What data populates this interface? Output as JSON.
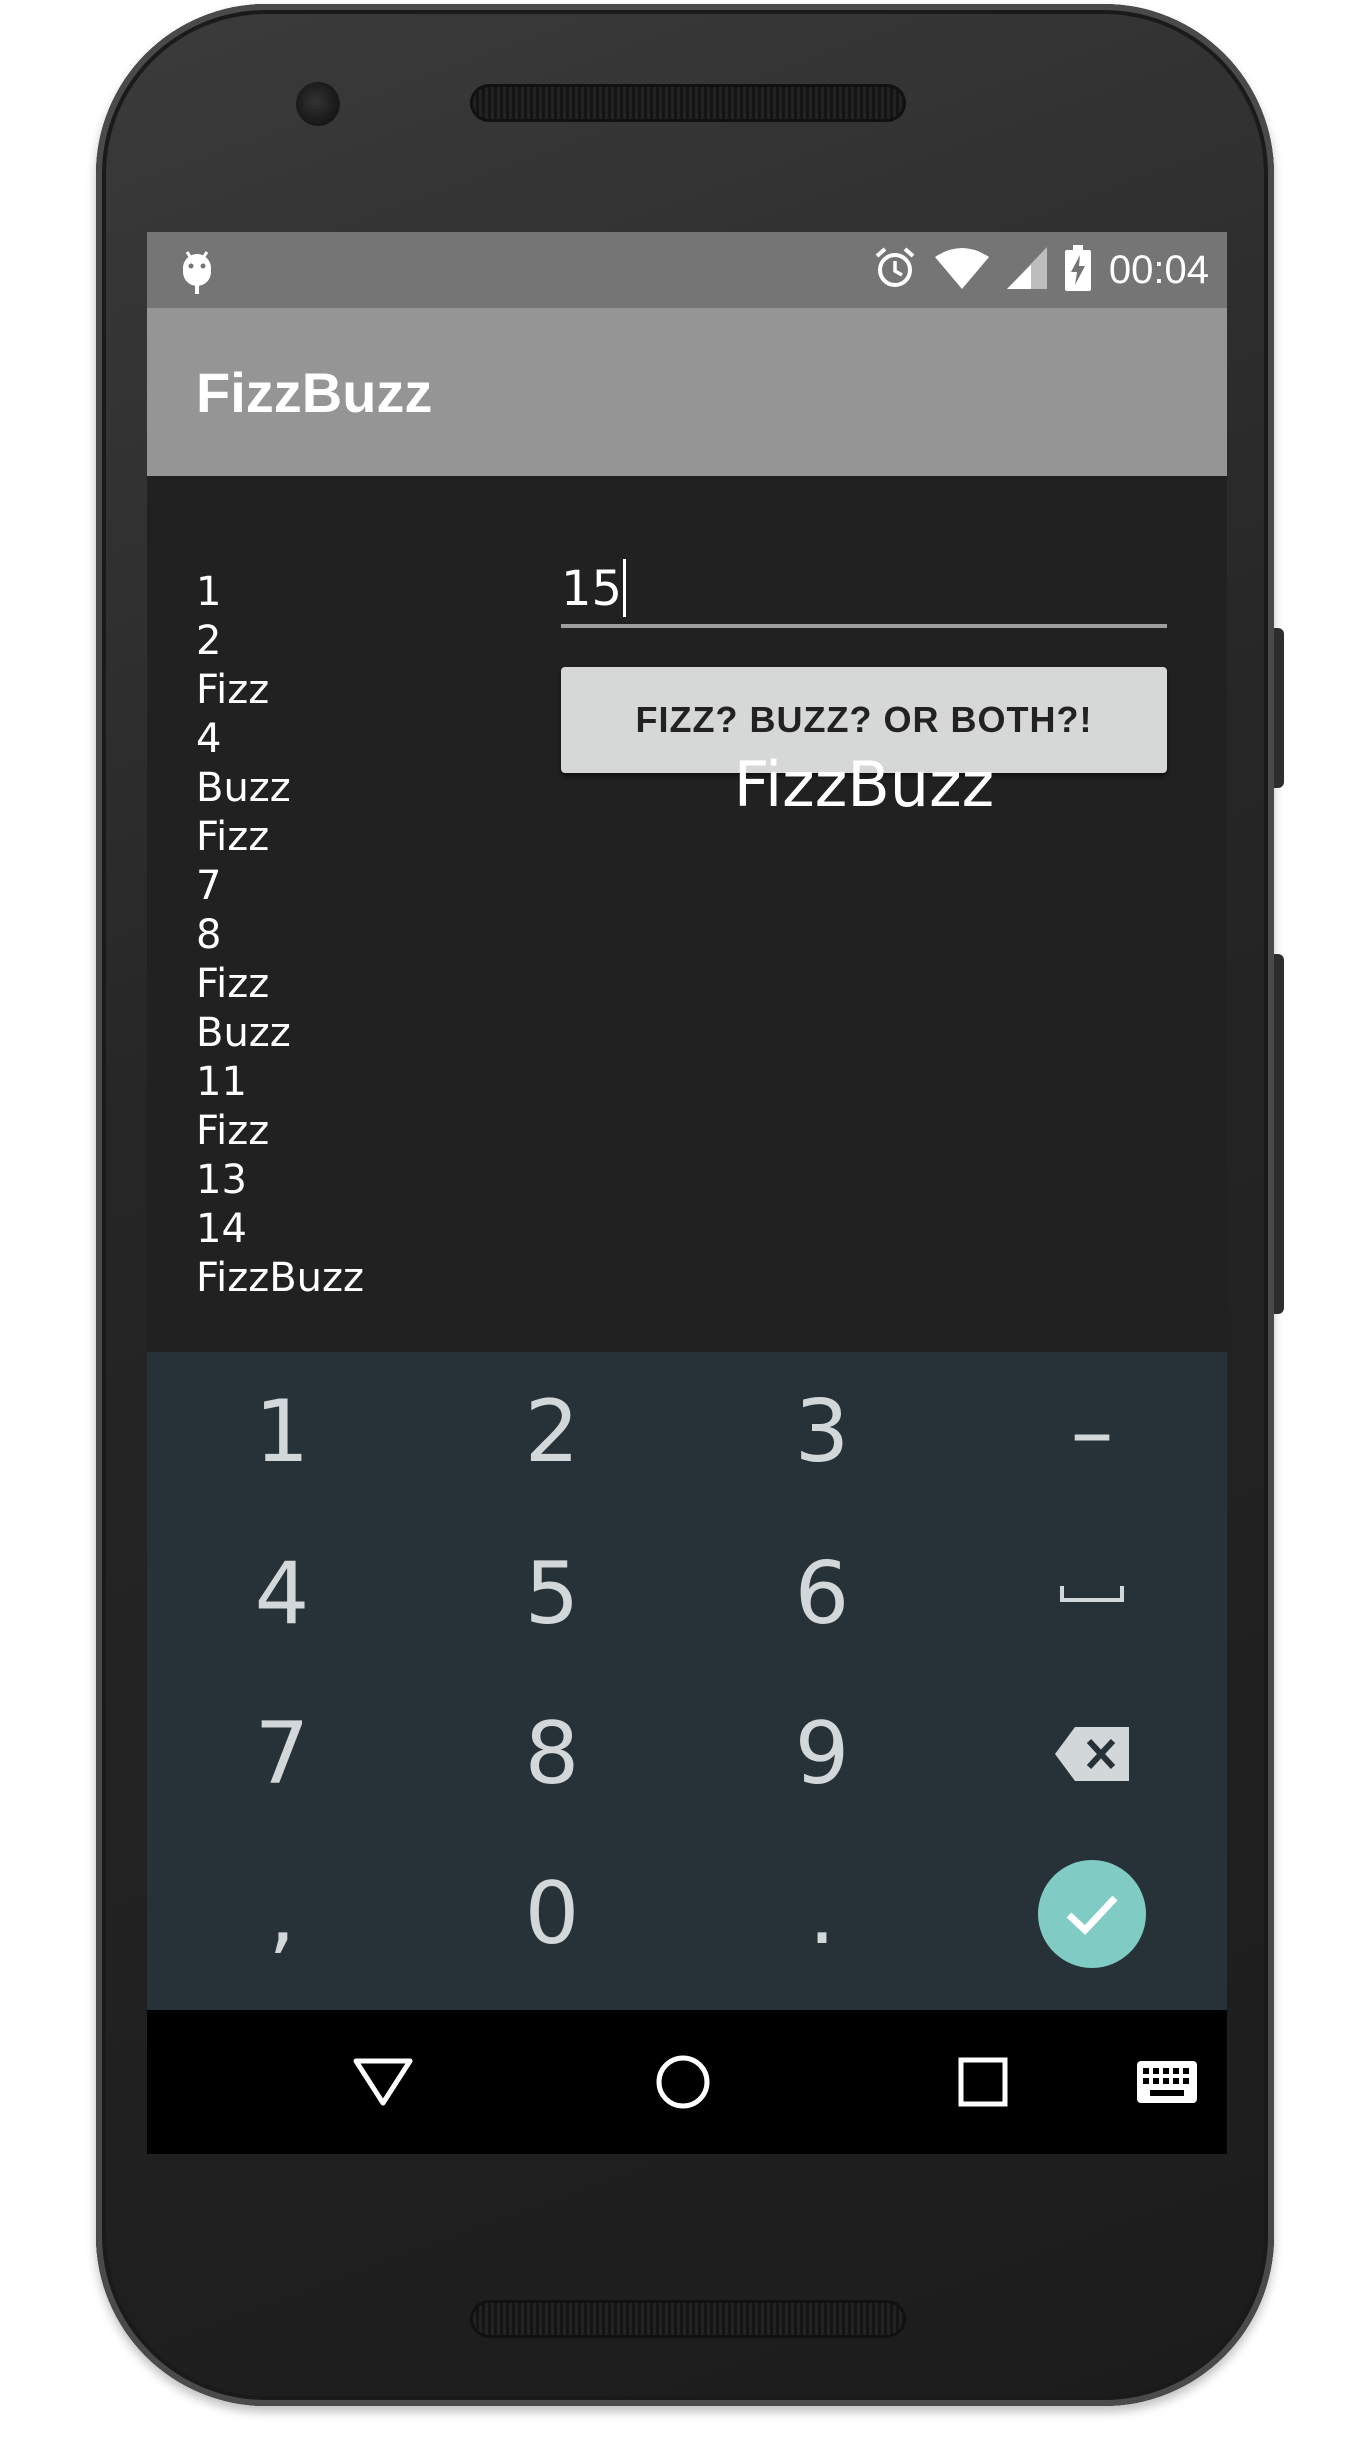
{
  "status_bar": {
    "time": "00:04",
    "icons": [
      "android-debug-icon",
      "alarm-icon",
      "wifi-icon",
      "cell-signal-icon",
      "battery-charging-icon"
    ]
  },
  "app_bar": {
    "title": "FizzBuzz"
  },
  "results": [
    "1",
    "2",
    "Fizz",
    "4",
    "Buzz",
    "Fizz",
    "7",
    "8",
    "Fizz",
    "Buzz",
    "11",
    "Fizz",
    "13",
    "14",
    "FizzBuzz"
  ],
  "number_input": {
    "value": "15"
  },
  "fizz_button": {
    "label": "FIZZ? BUZZ? OR BOTH?!"
  },
  "answer": "FizzBuzz",
  "keyboard": {
    "keys": [
      "1",
      "2",
      "3",
      "–",
      "4",
      "5",
      "6",
      "␣",
      "7",
      "8",
      "9",
      "⌫",
      ",",
      "0",
      ".",
      "✓"
    ],
    "colors": {
      "background": "#263238",
      "done": "#80cbc4",
      "key_text": "#d2d7d9"
    }
  },
  "nav_bar": {
    "buttons": [
      "back-icon",
      "home-icon",
      "recents-icon",
      "keyboard-switch-icon"
    ]
  },
  "colors": {
    "status_bar": "#757575",
    "app_bar": "#959595",
    "content_bg": "#212121",
    "button_bg": "#d6d7d7"
  }
}
